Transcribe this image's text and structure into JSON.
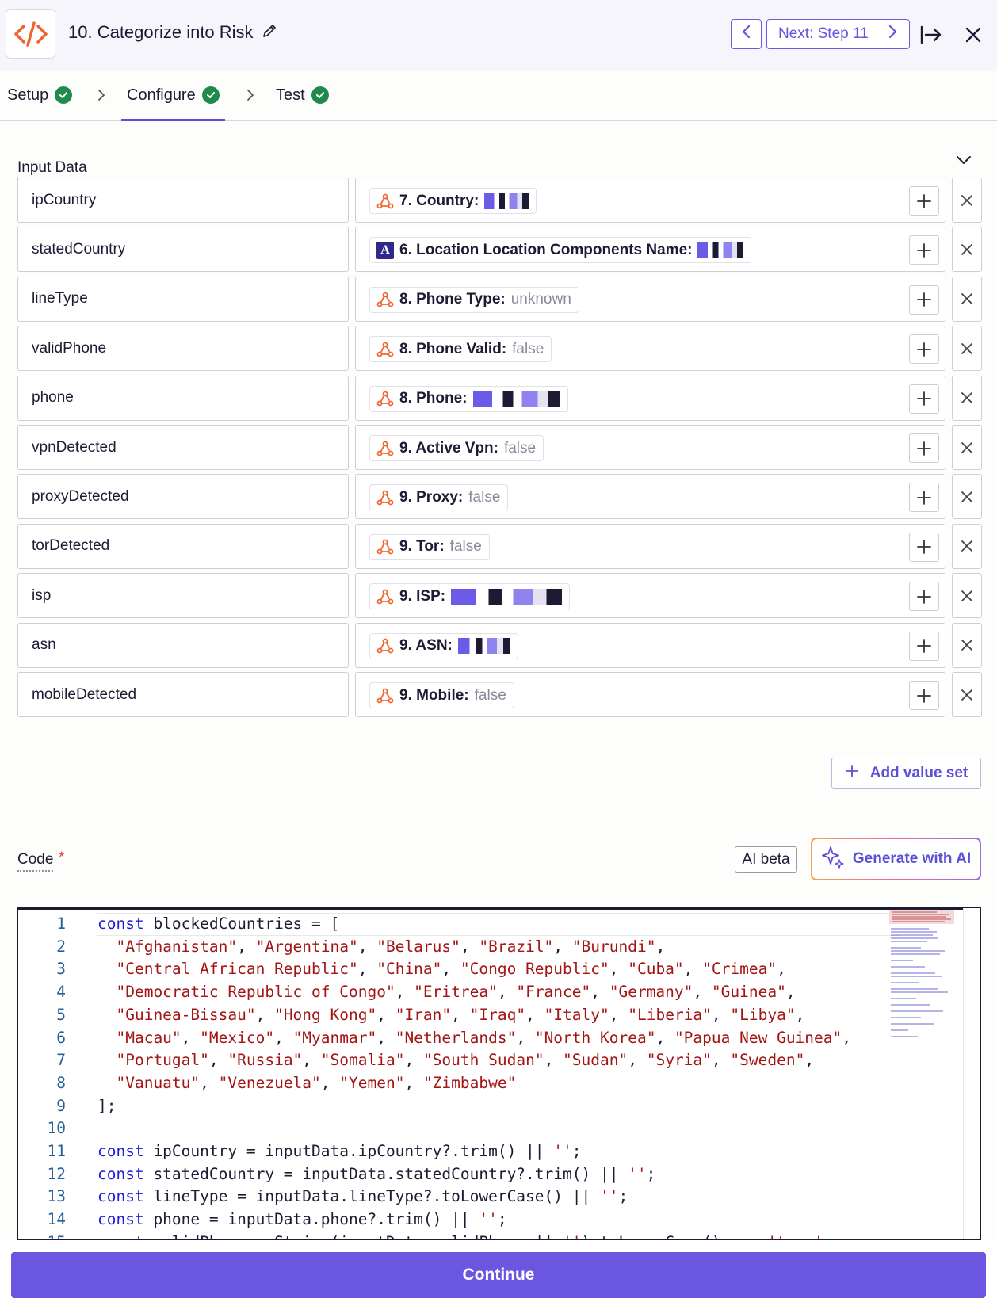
{
  "header": {
    "title": "10. Categorize into Risk",
    "next_label": "Next: Step 11"
  },
  "tabs": [
    {
      "label": "Setup"
    },
    {
      "label": "Configure"
    },
    {
      "label": "Test"
    }
  ],
  "input_data": {
    "label": "Input Data",
    "rows": [
      {
        "key": "ipCountry",
        "label": "7. Country:",
        "value": "",
        "redacted": true,
        "app": "webhook"
      },
      {
        "key": "statedCountry",
        "label": "6. Location Location Components Name:",
        "value": "",
        "redacted": true,
        "app": "A"
      },
      {
        "key": "lineType",
        "label": "8. Phone Type:",
        "value": "unknown",
        "redacted": false,
        "app": "webhook"
      },
      {
        "key": "validPhone",
        "label": "8. Phone Valid:",
        "value": "false",
        "redacted": false,
        "app": "webhook"
      },
      {
        "key": "phone",
        "label": "8. Phone:",
        "value": "",
        "redacted": true,
        "app": "webhook"
      },
      {
        "key": "vpnDetected",
        "label": "9. Active Vpn:",
        "value": "false",
        "redacted": false,
        "app": "webhook"
      },
      {
        "key": "proxyDetected",
        "label": "9. Proxy:",
        "value": "false",
        "redacted": false,
        "app": "webhook"
      },
      {
        "key": "torDetected",
        "label": "9. Tor:",
        "value": "false",
        "redacted": false,
        "app": "webhook"
      },
      {
        "key": "isp",
        "label": "9. ISP:",
        "value": "",
        "redacted": true,
        "app": "webhook"
      },
      {
        "key": "asn",
        "label": "9. ASN:",
        "value": "",
        "redacted": true,
        "app": "webhook"
      },
      {
        "key": "mobileDetected",
        "label": "9. Mobile:",
        "value": "false",
        "redacted": false,
        "app": "webhook"
      }
    ],
    "add_value_set": "Add value set"
  },
  "code": {
    "label": "Code",
    "required_mark": "*",
    "ai_beta": "AI beta",
    "generate_label": "Generate with AI",
    "lines": [
      "const blockedCountries = [",
      "  \"Afghanistan\", \"Argentina\", \"Belarus\", \"Brazil\", \"Burundi\",",
      "  \"Central African Republic\", \"China\", \"Congo Republic\", \"Cuba\", \"Crimea\",",
      "  \"Democratic Republic of Congo\", \"Eritrea\", \"France\", \"Germany\", \"Guinea\",",
      "  \"Guinea-Bissau\", \"Hong Kong\", \"Iran\", \"Iraq\", \"Italy\", \"Liberia\", \"Libya\",",
      "  \"Macau\", \"Mexico\", \"Myanmar\", \"Netherlands\", \"North Korea\", \"Papua New Guinea\",",
      "  \"Portugal\", \"Russia\", \"Somalia\", \"South Sudan\", \"Sudan\", \"Syria\", \"Sweden\",",
      "  \"Vanuatu\", \"Venezuela\", \"Yemen\", \"Zimbabwe\"",
      "];",
      "",
      "const ipCountry = inputData.ipCountry?.trim() || '';",
      "const statedCountry = inputData.statedCountry?.trim() || '';",
      "const lineType = inputData.lineType?.toLowerCase() || '';",
      "const phone = inputData.phone?.trim() || '';",
      "const validPhone = String(inputData.validPhone || '').toLowerCase() === 'true';"
    ]
  },
  "footer": {
    "continue_label": "Continue"
  }
}
